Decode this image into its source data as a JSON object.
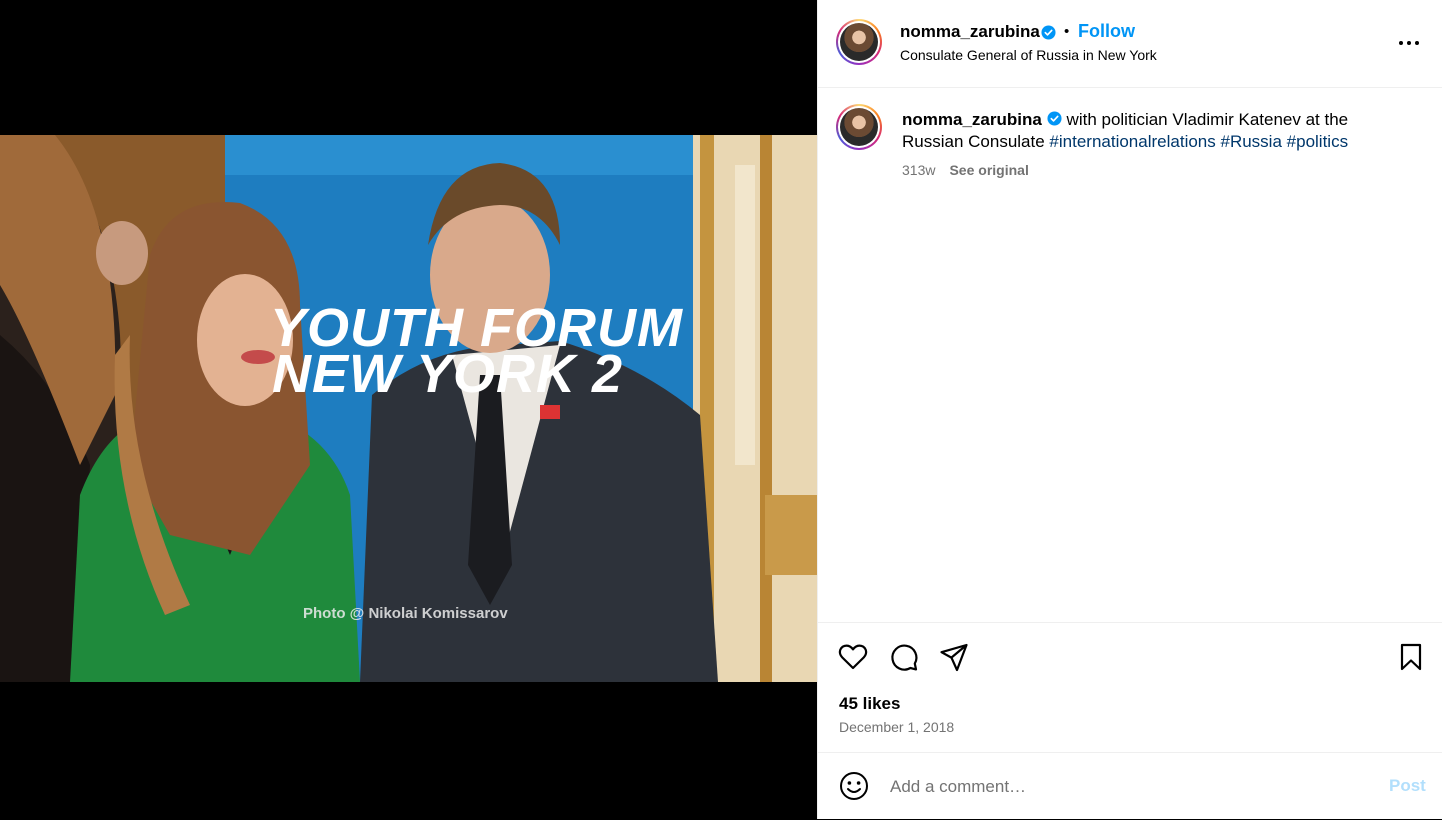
{
  "media": {
    "banner_line1": "YOUTH FORUM",
    "banner_line2": "NEW YORK 2",
    "photo_credit": "Photo @ Nikolai Komissarov"
  },
  "header": {
    "username": "nomma_zarubina",
    "separator": "•",
    "follow_label": "Follow",
    "location": "Consulate General of Russia in New York",
    "verified_icon": "verified-badge-icon",
    "more_icon": "more-options-icon"
  },
  "caption": {
    "username": "nomma_zarubina",
    "text": " with politician Vladimir Katenev at the Russian Consulate ",
    "hashtags": [
      "#internationalrelations",
      "#Russia",
      "#politics"
    ],
    "age": "313w",
    "see_original": "See original"
  },
  "actions": {
    "icons": [
      "heart-icon",
      "comment-icon",
      "share-icon",
      "bookmark-icon"
    ],
    "likes": "45 likes",
    "date": "December 1, 2018"
  },
  "comment": {
    "emoji_icon": "emoji-icon",
    "placeholder": "Add a comment…",
    "post_label": "Post"
  },
  "colors": {
    "accent": "#0095f6",
    "hashtag": "#00376b",
    "muted": "#737373",
    "post_disabled": "#b2dffc"
  }
}
